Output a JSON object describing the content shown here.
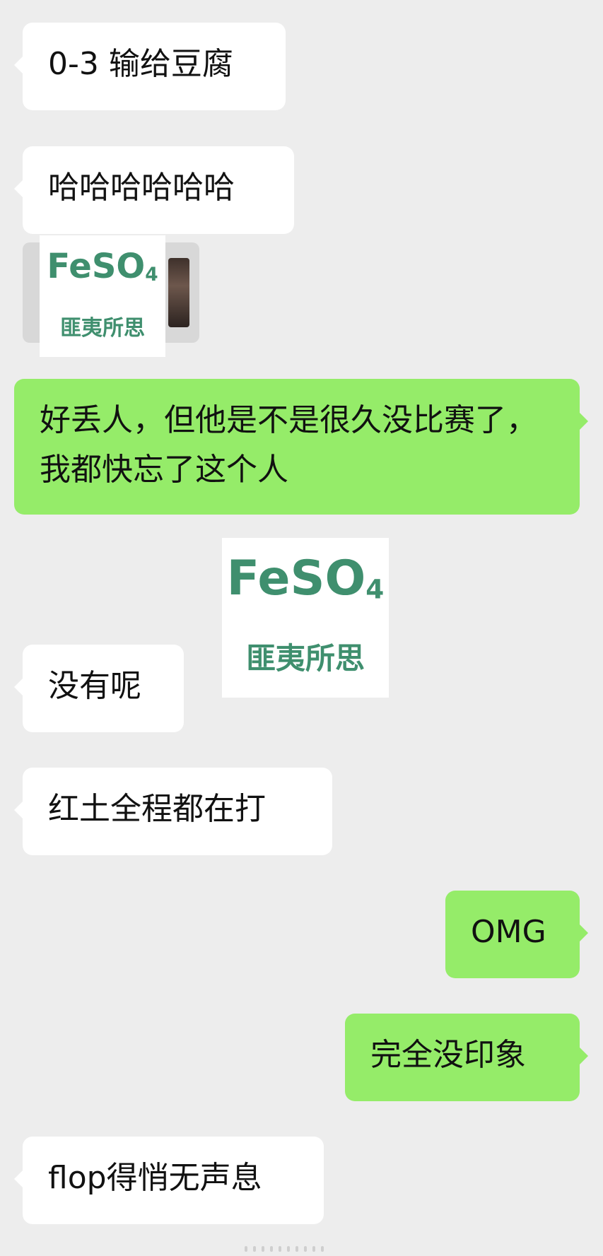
{
  "chat": {
    "messages": [
      {
        "side": "in",
        "text": "0-3 输给豆腐"
      },
      {
        "side": "in",
        "text": "哈哈哈哈哈哈"
      },
      {
        "side": "in",
        "text": "好丢人，但他是不是很久没比赛了，我都快忘了这个人"
      },
      {
        "side": "in",
        "text": "没有呢"
      },
      {
        "side": "in",
        "text": "红土全程都在打"
      },
      {
        "side": "out",
        "text": "OMG"
      },
      {
        "side": "out",
        "text": "完全没印象"
      },
      {
        "side": "in",
        "text": "flop得悄无声息"
      }
    ]
  },
  "watermark": {
    "brand_main": "FeSO",
    "brand_subscript": "4",
    "subtitle": "匪夷所思"
  },
  "colors": {
    "background": "#ededed",
    "incoming_bubble": "#ffffff",
    "outgoing_bubble": "#95ec69",
    "watermark_text": "#3f8f6e"
  }
}
